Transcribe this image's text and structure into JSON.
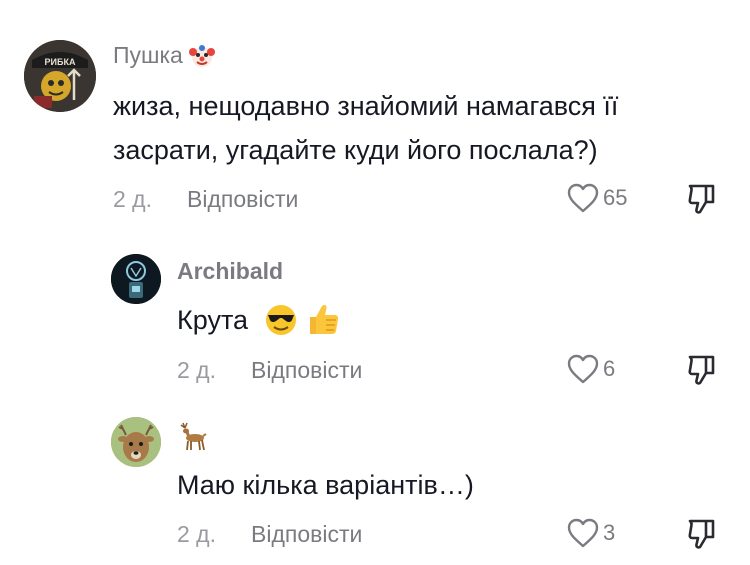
{
  "comments": [
    {
      "username": "Пушка",
      "username_emoji": "clown-face-icon",
      "avatar_text": "РИБКА",
      "text_line1": "жиза, нещодавно знайомий намагався її",
      "text_line2": "засрати, угадайте куди його послала?)",
      "time": "2 д.",
      "reply_label": "Відповісти",
      "likes": "65"
    },
    {
      "username": "Archibald",
      "text": "Крута",
      "emojis": [
        "smiling-face-with-sunglasses-icon",
        "thumbs-up-icon"
      ],
      "time": "2 д.",
      "reply_label": "Відповісти",
      "likes": "6"
    },
    {
      "username_emoji": "deer-icon",
      "text": "Маю кілька варіантів…)",
      "time": "2 д.",
      "reply_label": "Відповісти",
      "likes": "3"
    }
  ],
  "colors": {
    "text": "#161823",
    "muted": "#7a7b80",
    "background": "#ffffff"
  }
}
